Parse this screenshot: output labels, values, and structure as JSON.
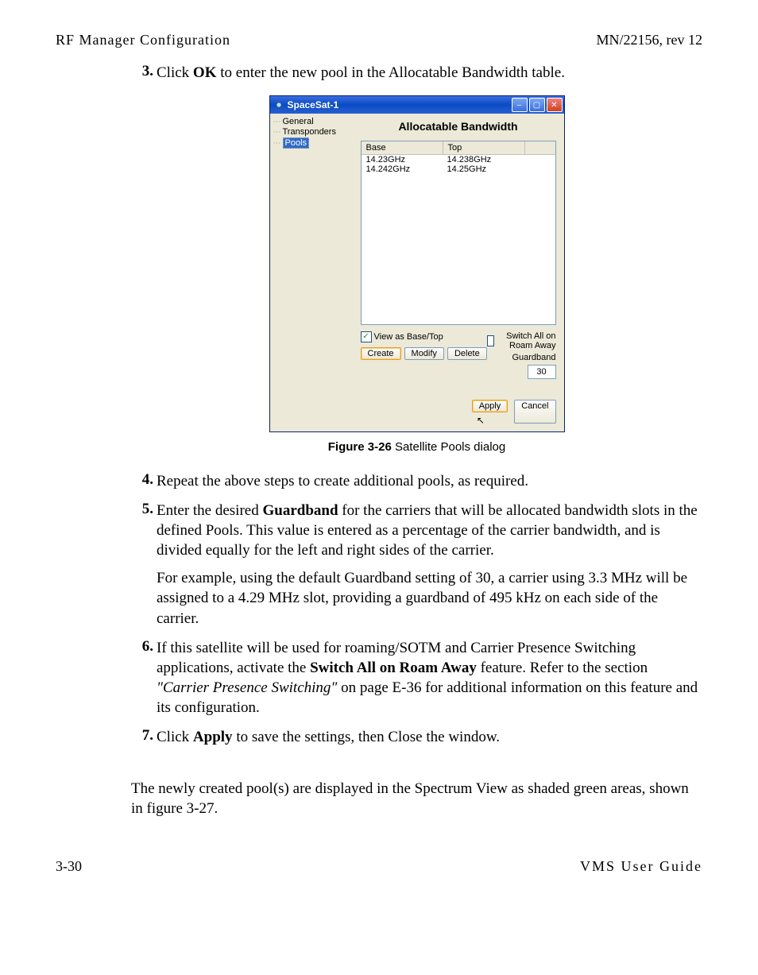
{
  "header": {
    "left": "RF Manager Configuration",
    "right": "MN/22156, rev 12"
  },
  "steps": {
    "s3": {
      "num": "3.",
      "pre": "Click ",
      "bold": "OK",
      "post": " to enter the new pool in the Allocatable Bandwidth table."
    },
    "s4": {
      "num": "4.",
      "text": "Repeat the above steps to create additional pools, as required."
    },
    "s5": {
      "num": "5.",
      "pre": "Enter the desired ",
      "bold": "Guardband",
      "post": " for the carriers that will be allocated bandwidth slots in the defined Pools. This value is entered as a percentage of the carrier bandwidth, and is divided equally for the left and right sides of the carrier.",
      "sub": "For example, using the default Guardband setting of 30, a carrier using 3.3 MHz will be assigned to a 4.29 MHz slot, providing a guardband of 495 kHz on each side of the carrier."
    },
    "s6": {
      "num": "6.",
      "pre": "If this satellite will be used for roaming/SOTM and Carrier Presence Switching applications, activate the ",
      "bold": "Switch All on Roam Away",
      "mid": " feature. Refer to the section ",
      "italic": "\"Carrier Presence Switching\"",
      "post": " on page E-36 for additional information on this feature and its configuration."
    },
    "s7": {
      "num": "7.",
      "pre": "Click ",
      "bold": "Apply",
      "post": " to save the settings, then Close the window."
    }
  },
  "figure": {
    "caption_bold": "Figure 3-26",
    "caption_rest": "  Satellite Pools dialog"
  },
  "dialog": {
    "title": "SpaceSat-1",
    "tree": {
      "items": [
        "General",
        "Transponders",
        "Pools"
      ],
      "selected_index": 2
    },
    "main_title": "Allocatable Bandwidth",
    "columns": [
      "Base",
      "Top"
    ],
    "rows": [
      {
        "base": "14.23GHz",
        "top": "14.238GHz"
      },
      {
        "base": "14.242GHz",
        "top": "14.25GHz"
      }
    ],
    "view_as_label": "View as Base/Top",
    "switch_label": "Switch All on Roam Away",
    "guardband_label": "Guardband",
    "guardband_value": "30",
    "buttons": {
      "create": "Create",
      "modify": "Modify",
      "delete": "Delete"
    },
    "bottom": {
      "apply": "Apply",
      "cancel": "Cancel"
    }
  },
  "bodypara": "The newly created pool(s) are displayed in the Spectrum View as shaded green areas, shown in figure 3-27.",
  "footer": {
    "left": "3-30",
    "right": "VMS User Guide"
  }
}
